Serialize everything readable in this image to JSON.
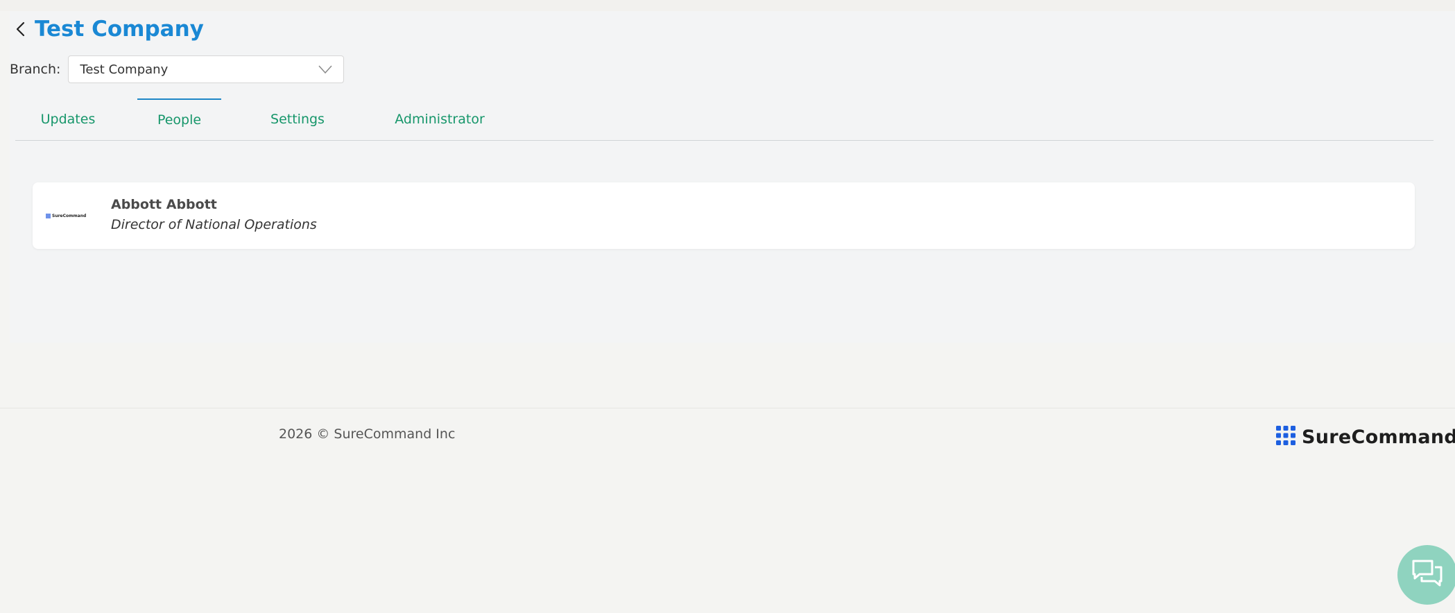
{
  "header": {
    "title": "Test Company"
  },
  "branch": {
    "label": "Branch:",
    "selected": "Test Company"
  },
  "tabs": [
    {
      "label": "Updates",
      "active": false
    },
    {
      "label": "People",
      "active": true
    },
    {
      "label": "Settings",
      "active": false
    },
    {
      "label": "Administrator",
      "active": false
    }
  ],
  "people": [
    {
      "name": "Abbott Abbott",
      "title": "Director of National Operations",
      "logo_text": "SureCommand"
    }
  ],
  "footer": {
    "copyright": "2026 © SureCommand Inc",
    "brand": "SureCommand"
  },
  "colors": {
    "title_blue": "#1a88d4",
    "tab_green": "#16966a",
    "tab_active_bar": "#1d86c6",
    "logo_blue": "#1d5fe0",
    "chat_bubble": "#8fd3bf"
  },
  "icons": {
    "back": "chevron-left-icon",
    "select": "chevron-down-icon",
    "brand": "grid-dots-icon",
    "chat": "chat-bubbles-icon"
  }
}
